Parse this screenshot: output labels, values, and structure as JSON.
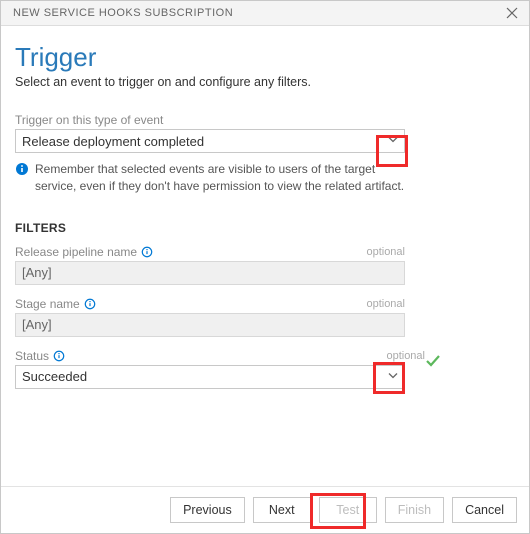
{
  "dialogTitle": "NEW SERVICE HOOKS SUBSCRIPTION",
  "pageTitle": "Trigger",
  "subtitle": "Select an event to trigger on and configure any filters.",
  "trigger": {
    "label": "Trigger on this type of event",
    "value": "Release deployment completed"
  },
  "infoText": "Remember that selected events are visible to users of the target service, even if they don't have permission to view the related artifact.",
  "filtersHeading": "FILTERS",
  "optionalText": "optional",
  "filters": {
    "releasePipeline": {
      "label": "Release pipeline name",
      "value": "[Any]"
    },
    "stageName": {
      "label": "Stage name",
      "value": "[Any]"
    },
    "status": {
      "label": "Status",
      "value": "Succeeded"
    }
  },
  "buttons": {
    "previous": "Previous",
    "next": "Next",
    "test": "Test",
    "finish": "Finish",
    "cancel": "Cancel"
  }
}
